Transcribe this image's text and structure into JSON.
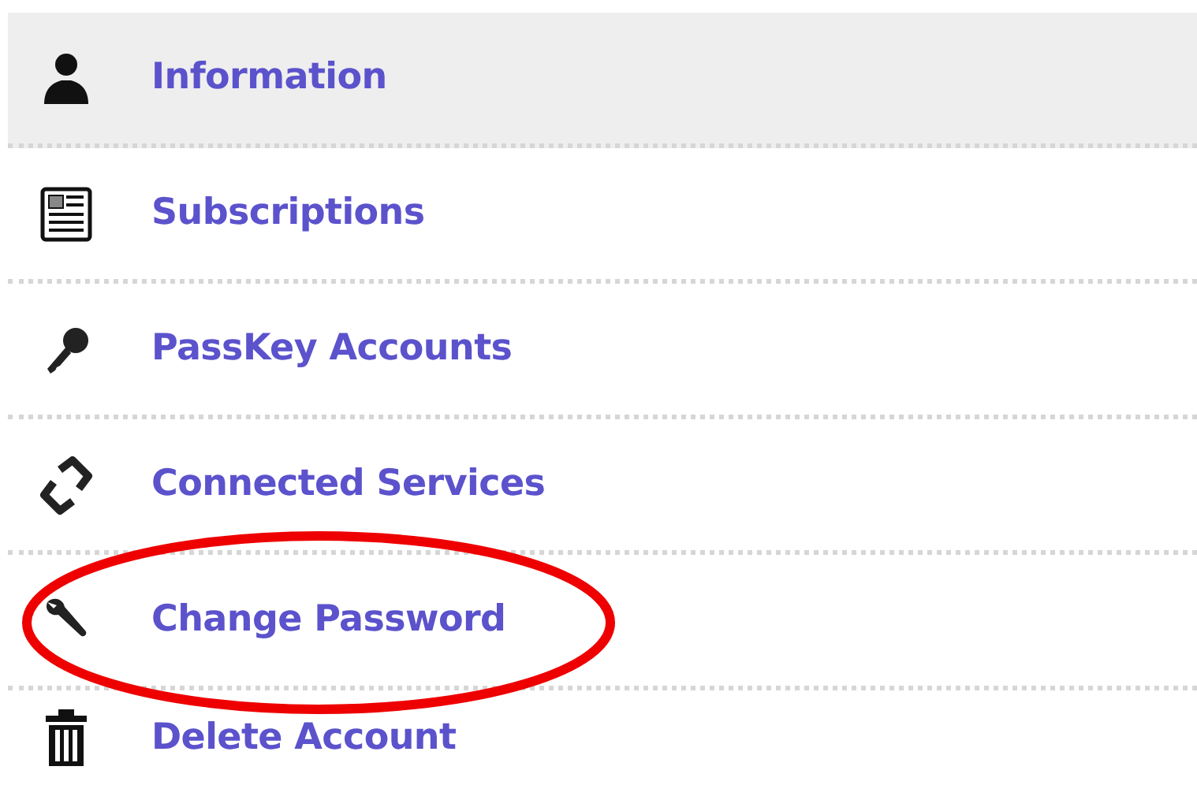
{
  "menu": {
    "items": [
      {
        "label": "Information",
        "kind": "person",
        "selected": true,
        "highlighted": false
      },
      {
        "label": "Subscriptions",
        "kind": "newspaper",
        "selected": false,
        "highlighted": false
      },
      {
        "label": "PassKey Accounts",
        "kind": "key",
        "selected": false,
        "highlighted": false
      },
      {
        "label": "Connected Services",
        "kind": "link",
        "selected": false,
        "highlighted": false
      },
      {
        "label": "Change Password",
        "kind": "wrench",
        "selected": false,
        "highlighted": true
      },
      {
        "label": "Delete Account",
        "kind": "trash",
        "selected": false,
        "highlighted": false
      }
    ]
  }
}
